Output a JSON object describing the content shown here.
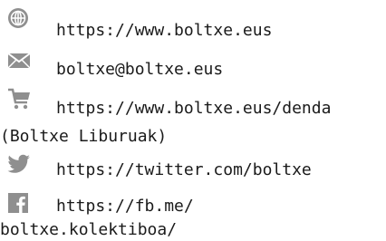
{
  "icon_color": "#8f8f8f",
  "contacts": [
    {
      "icon": "globe-icon",
      "text": "https://www.boltxe.eus"
    },
    {
      "icon": "mail-icon",
      "text": "boltxe@boltxe.eus"
    },
    {
      "icon": "cart-icon",
      "text": "https://www.boltxe.eus/denda",
      "text_line2": "(Boltxe Liburuak)"
    },
    {
      "icon": "twitter-icon",
      "text": "https://twitter.com/boltxe"
    },
    {
      "icon": "facebook-icon",
      "text": "https://fb.me/",
      "text_line2": "boltxe.kolektiboa/"
    }
  ]
}
